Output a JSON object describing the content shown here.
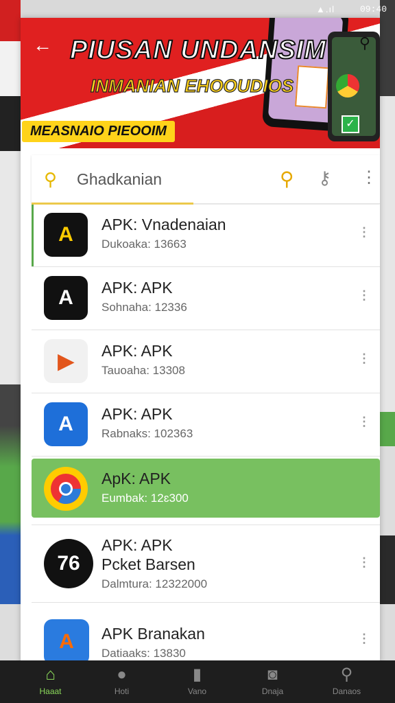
{
  "status_bar": {
    "signal": "▲.ıl",
    "time": "09:40"
  },
  "banner": {
    "title": "PIUSAN UNDANSIM",
    "subtitle": "INMANIAN EHOOUDIOS",
    "badge": "MEASNAIO PIEOOIM",
    "back_icon": "arrow-left-icon",
    "search_icon": "search-icon"
  },
  "search": {
    "query": "Ghadkanian"
  },
  "apps": [
    {
      "name": "APK: Vnadenaian",
      "sub": "Dukoaka: 13663",
      "icon_text": "A"
    },
    {
      "name": "APK: APK",
      "sub": "Sohnaha: 12336",
      "icon_text": "A"
    },
    {
      "name": "APK: APK",
      "sub": "Tauoaha: 13308",
      "icon_text": "▶"
    },
    {
      "name": "APK: APK",
      "sub": "Rabnaks: 102363",
      "icon_text": "A"
    },
    {
      "name": "ApK: APK",
      "sub": "Eumbak: 12ɛ300",
      "icon_text": ""
    },
    {
      "name": "APK: APK",
      "name2": "Pcket Barsen",
      "sub": "Dalmtura: 12322000",
      "icon_text": "76"
    },
    {
      "name": "APK Branakan",
      "sub": "Datiaaks: 13830",
      "icon_text": "A"
    }
  ],
  "nav": [
    {
      "label": "Haaat",
      "icon": "home-icon",
      "glyph": "⌂"
    },
    {
      "label": "Hoti",
      "icon": "person-icon",
      "glyph": "●"
    },
    {
      "label": "Vano",
      "icon": "square-icon",
      "glyph": "▮"
    },
    {
      "label": "Dnaja",
      "icon": "camera-icon",
      "glyph": "◙"
    },
    {
      "label": "Danaos",
      "icon": "search-icon",
      "glyph": "⚲"
    }
  ]
}
